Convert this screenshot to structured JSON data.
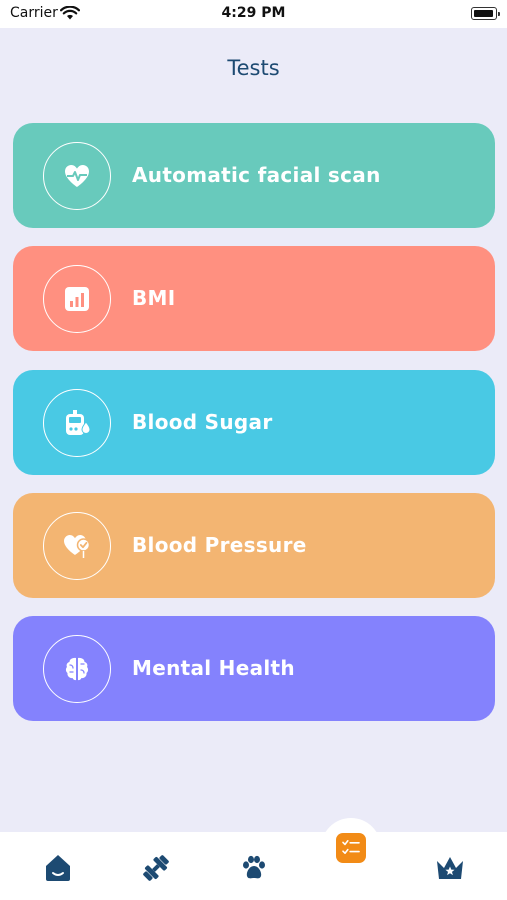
{
  "status_bar": {
    "carrier": "Carrier",
    "time": "4:29 PM"
  },
  "page": {
    "title": "Tests"
  },
  "tests": [
    {
      "label": "Automatic facial scan",
      "icon": "heart-pulse-icon",
      "color": "#68cabc"
    },
    {
      "label": "BMI",
      "icon": "bar-chart-icon",
      "color": "#ff9080"
    },
    {
      "label": "Blood Sugar",
      "icon": "glucose-meter-icon",
      "color": "#49c9e4"
    },
    {
      "label": "Blood Pressure",
      "icon": "heart-check-icon",
      "color": "#f3b572"
    },
    {
      "label": "Mental Health",
      "icon": "brain-icon",
      "color": "#8482fd"
    }
  ],
  "tab_bar": {
    "items": [
      "home-icon",
      "dumbbell-icon",
      "paw-icon",
      "checklist-icon",
      "crown-icon"
    ],
    "active": "checklist-icon",
    "active_color": "#f28b16",
    "icon_color": "#1d4a72"
  }
}
